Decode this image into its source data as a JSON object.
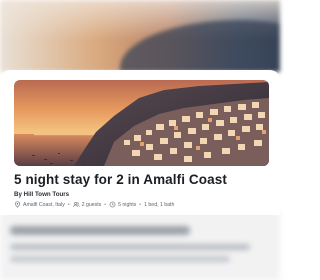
{
  "listing": {
    "title": "5 night stay for 2 in Amalfi Coast",
    "operator": "By Hill Town Tours",
    "meta": {
      "location": "Amalfi Coast, Italy",
      "guests": "2 guests",
      "nights": "5 nights",
      "rooms": "1 bed, 1 bath"
    },
    "image_alt_icon": "photo-of-amalfi-coast"
  },
  "icons": {
    "location": "map-pin-icon",
    "guests": "people-icon",
    "nights": "clock-icon"
  },
  "colors": {
    "title": "#1b1f24",
    "meta_text": "#5e646c"
  }
}
